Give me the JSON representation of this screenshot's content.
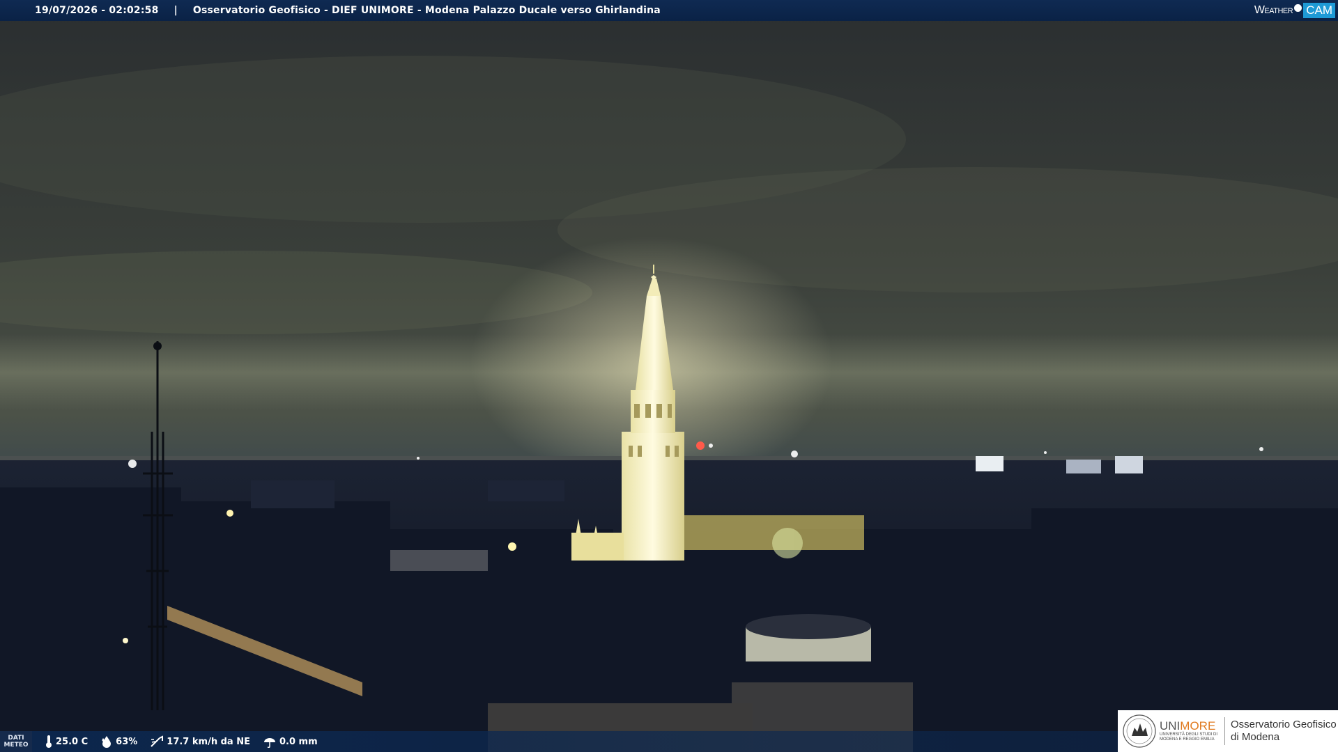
{
  "header": {
    "timestamp": "19/07/2026 - 02:02:58",
    "separator": "|",
    "title": "Osservatorio Geofisico - DIEF UNIMORE - Modena Palazzo Ducale verso Ghirlandina"
  },
  "logo": {
    "left": "Weather",
    "right": "CAM"
  },
  "footer": {
    "label_line1": "DATI",
    "label_line2": "METEO",
    "temperature": "25.0 C",
    "humidity": "63%",
    "wind": "17.7 km/h da NE",
    "rain": "0.0 mm"
  },
  "institution": {
    "uni_prefix": "UNI",
    "uni_suffix": "MORE",
    "uni_sub1": "UNIVERSITÀ DEGLI STUDI DI",
    "uni_sub2": "MODENA E REGGIO EMILIA",
    "observatory_line1": "Osservatorio Geofisico",
    "observatory_line2": "di Modena"
  },
  "colors": {
    "bar": "#0f2a52",
    "logo_cam": "#1e9ad6",
    "unimore_orange": "#e07a1f"
  }
}
